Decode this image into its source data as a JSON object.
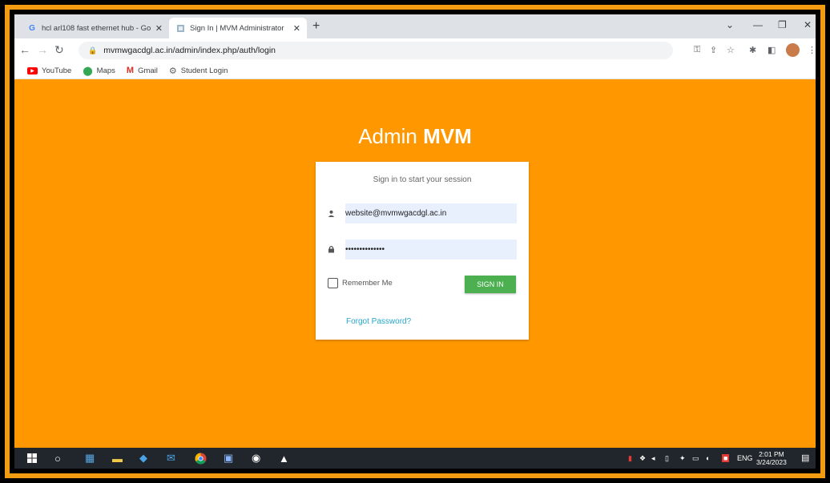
{
  "browser": {
    "tabs": [
      {
        "title": "hcl arl108 fast ethernet hub - Go",
        "favicon": "G"
      },
      {
        "title": "Sign In | MVM Administrator"
      }
    ],
    "new_tab_label": "+",
    "url": "mvmwgacdgl.ac.in/admin/index.php/auth/login"
  },
  "bookmarks": [
    {
      "label": "YouTube",
      "icon": "youtube-icon"
    },
    {
      "label": "Maps",
      "icon": "maps-pin-icon"
    },
    {
      "label": "Gmail",
      "icon": "gmail-icon"
    },
    {
      "label": "Student Login",
      "icon": "gear-icon"
    }
  ],
  "page": {
    "brand_light": "Admin",
    "brand_bold": "MVM",
    "login_message": "Sign in to start your session",
    "email_value": "website@mvmwgacdgl.ac.in",
    "password_value": "••••••••••••••",
    "remember_label": "Remember Me",
    "signin_label": "SIGN IN",
    "forgot_label": "Forgot Password?"
  },
  "taskbar": {
    "language": "ENG",
    "time": "2:01 PM",
    "date": "3/24/2023"
  },
  "colors": {
    "page_background": "#ff9800",
    "signin_button": "#4caf50",
    "link": "#26a6c8"
  }
}
